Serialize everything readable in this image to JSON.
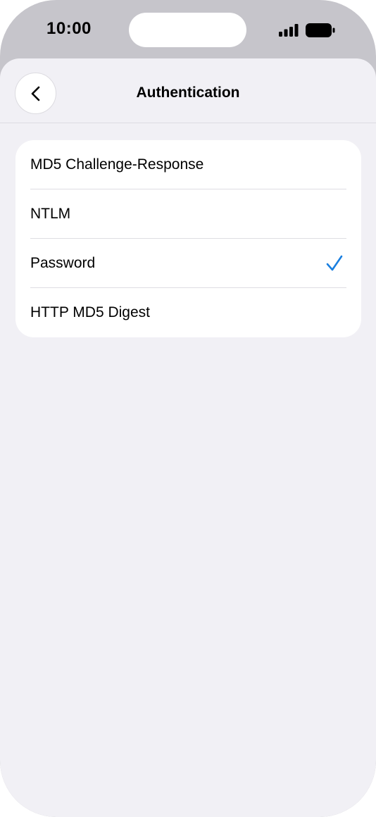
{
  "status_bar": {
    "time": "10:00",
    "signal_icon": "signal-bars-icon",
    "battery_icon": "battery-full-icon"
  },
  "nav": {
    "back_icon": "chevron-left-icon",
    "title": "Authentication"
  },
  "options": [
    {
      "label": "MD5 Challenge-Response",
      "selected": false
    },
    {
      "label": "NTLM",
      "selected": false
    },
    {
      "label": "Password",
      "selected": true
    },
    {
      "label": "HTTP MD5 Digest",
      "selected": false
    }
  ],
  "colors": {
    "accent": "#1a7fe0",
    "background": "#f1f0f5",
    "card": "#ffffff"
  }
}
